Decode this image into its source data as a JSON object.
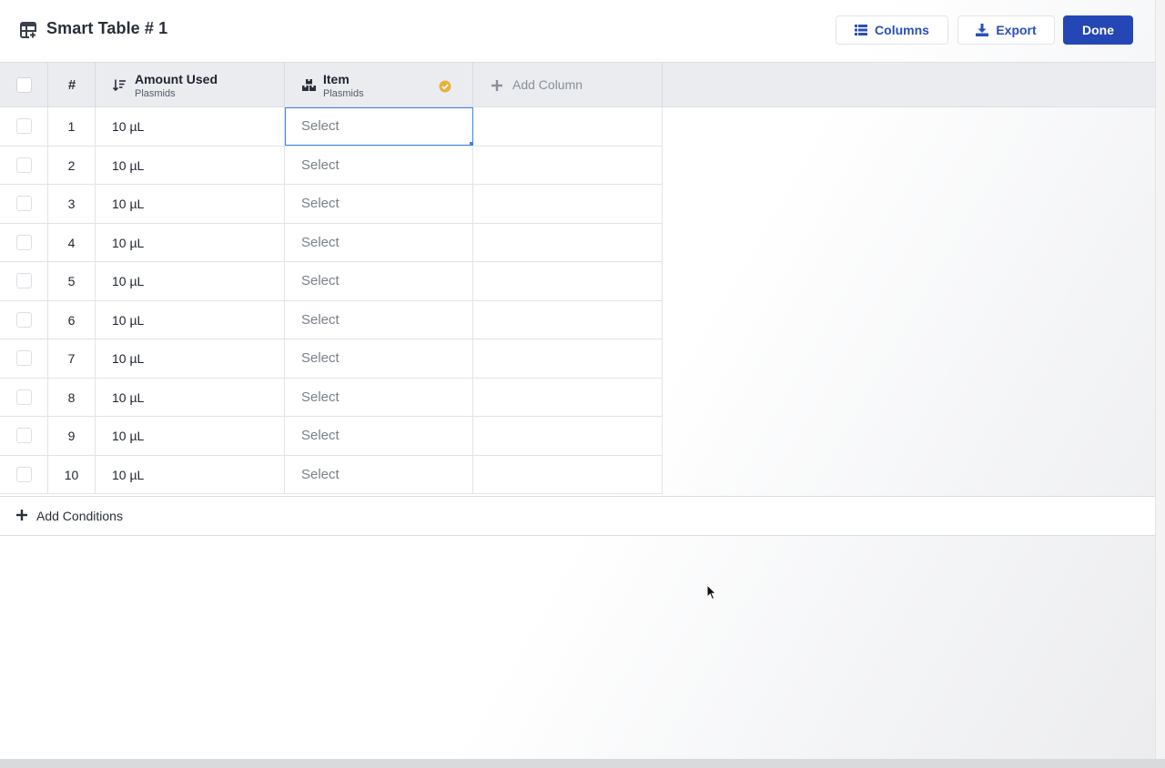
{
  "header": {
    "title": "Smart Table # 1",
    "columns_label": "Columns",
    "export_label": "Export",
    "done_label": "Done"
  },
  "table": {
    "hash_header": "#",
    "columns": [
      {
        "title": "Amount Used",
        "subtitle": "Plasmids",
        "icon": "sort-icon"
      },
      {
        "title": "Item",
        "subtitle": "Plasmids",
        "icon": "boxes-icon",
        "status_icon": "check-circle-icon"
      }
    ],
    "add_column_label": "Add Column",
    "rows": [
      {
        "num": "1",
        "amount": "10 µL",
        "item": "Select"
      },
      {
        "num": "2",
        "amount": "10 µL",
        "item": "Select"
      },
      {
        "num": "3",
        "amount": "10 µL",
        "item": "Select"
      },
      {
        "num": "4",
        "amount": "10 µL",
        "item": "Select"
      },
      {
        "num": "5",
        "amount": "10 µL",
        "item": "Select"
      },
      {
        "num": "6",
        "amount": "10 µL",
        "item": "Select"
      },
      {
        "num": "7",
        "amount": "10 µL",
        "item": "Select"
      },
      {
        "num": "8",
        "amount": "10 µL",
        "item": "Select"
      },
      {
        "num": "9",
        "amount": "10 µL",
        "item": "Select"
      },
      {
        "num": "10",
        "amount": "10 µL",
        "item": "Select"
      }
    ]
  },
  "conditions": {
    "add_label": "Add Conditions"
  },
  "colors": {
    "primary": "#2447b5",
    "accent_text": "#2a4fb8",
    "status_check": "#e8b23a",
    "selection": "#3b82f6"
  }
}
